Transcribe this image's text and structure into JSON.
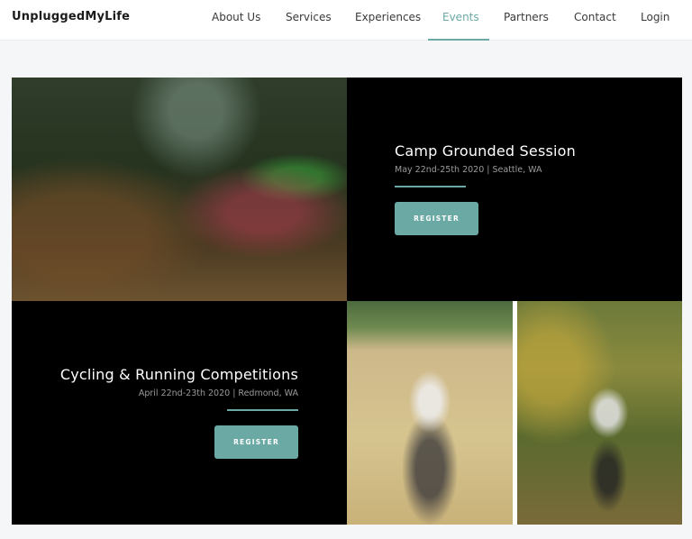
{
  "brand": "UnpluggedMyLife",
  "nav": {
    "items": [
      "About Us",
      "Services",
      "Experiences",
      "Events",
      "Partners",
      "Contact",
      "Login"
    ],
    "active": "Events"
  },
  "events": [
    {
      "title": "Camp Grounded Session",
      "meta": "May 22nd-25th 2020 | Seattle, WA",
      "button": "REGISTER"
    },
    {
      "title": "Cycling & Running Competitions",
      "meta": "April 22nd-23th 2020 | Redmond, WA",
      "button": "REGISTER"
    }
  ],
  "colors": {
    "accent": "#6aa9a4",
    "panel": "#000000",
    "background": "#f5f6f8"
  }
}
